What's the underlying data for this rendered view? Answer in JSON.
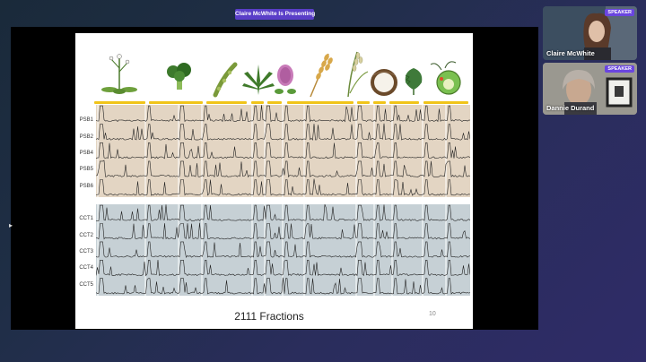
{
  "meeting": {
    "presenting_banner": "Claire McWhite Is Presenting"
  },
  "slide": {
    "psb_rows": [
      "PSB1",
      "PSB2",
      "PSB4",
      "PSB5",
      "PSB6"
    ],
    "cct_rows": [
      "CCT1",
      "CCT2",
      "CCT3",
      "CCT4",
      "CCT5"
    ],
    "caption": "2111 Fractions",
    "page_number": "10"
  },
  "participants": [
    {
      "name": "Claire McWhite",
      "badge": "SPEAKER"
    },
    {
      "name": "Dannie Durand",
      "badge": "SPEAKER"
    }
  ],
  "colors": {
    "accent": "#5a3ec8",
    "speaker_badge": "#6a45e0",
    "psb_panel": "#e3d5c3",
    "cct_panel": "#c6d0d5",
    "species_bar": "#f0c419"
  },
  "icons": [
    "arabidopsis-icon",
    "broccoli-icon",
    "soybean-icon",
    "cannabis-icon",
    "clover-icon",
    "wheat-icon",
    "rice-icon",
    "coconut-icon",
    "kale-icon",
    "chlamydomonas-icon"
  ]
}
